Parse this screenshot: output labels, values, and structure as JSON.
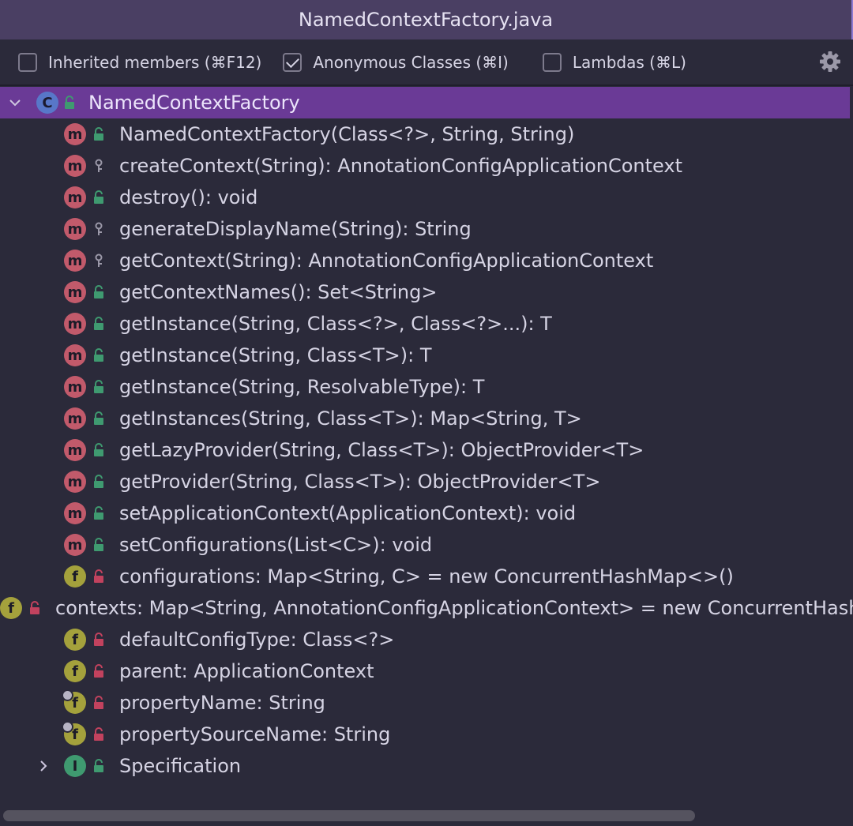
{
  "window": {
    "title": "NamedContextFactory.java"
  },
  "toolbar": {
    "options": [
      {
        "label": "Inherited members (⌘F12)",
        "checked": false
      },
      {
        "label": "Anonymous Classes (⌘I)",
        "checked": true
      },
      {
        "label": "Lambdas (⌘L)",
        "checked": false
      }
    ],
    "settings_icon": "gear-icon"
  },
  "tree": {
    "root": {
      "label": "NamedContextFactory",
      "kind": "class",
      "badge": "C",
      "expanded": true
    },
    "members": [
      {
        "badge": "m",
        "visibility": "public",
        "label": "NamedContextFactory(Class<?>, String, String)"
      },
      {
        "badge": "m",
        "visibility": "protected",
        "label": "createContext(String): AnnotationConfigApplicationContext"
      },
      {
        "badge": "m",
        "visibility": "public",
        "label": "destroy(): void"
      },
      {
        "badge": "m",
        "visibility": "protected",
        "label": "generateDisplayName(String): String"
      },
      {
        "badge": "m",
        "visibility": "protected",
        "label": "getContext(String): AnnotationConfigApplicationContext"
      },
      {
        "badge": "m",
        "visibility": "public",
        "label": "getContextNames(): Set<String>"
      },
      {
        "badge": "m",
        "visibility": "public",
        "label": "getInstance(String, Class<?>, Class<?>...): T"
      },
      {
        "badge": "m",
        "visibility": "public",
        "label": "getInstance(String, Class<T>): T"
      },
      {
        "badge": "m",
        "visibility": "public",
        "label": "getInstance(String, ResolvableType): T"
      },
      {
        "badge": "m",
        "visibility": "public",
        "label": "getInstances(String, Class<T>): Map<String, T>"
      },
      {
        "badge": "m",
        "visibility": "public",
        "label": "getLazyProvider(String, Class<T>): ObjectProvider<T>"
      },
      {
        "badge": "m",
        "visibility": "public",
        "label": "getProvider(String, Class<T>): ObjectProvider<T>"
      },
      {
        "badge": "m",
        "visibility": "public",
        "label": "setApplicationContext(ApplicationContext): void"
      },
      {
        "badge": "m",
        "visibility": "public",
        "label": "setConfigurations(List<C>): void"
      },
      {
        "badge": "f",
        "visibility": "private",
        "label": "configurations: Map<String, C> = new ConcurrentHashMap<>()"
      },
      {
        "badge": "f",
        "visibility": "private",
        "label": "contexts: Map<String, AnnotationConfigApplicationContext> = new ConcurrentHashMap<>()"
      },
      {
        "badge": "f",
        "visibility": "private",
        "label": "defaultConfigType: Class<?>"
      },
      {
        "badge": "f",
        "visibility": "private",
        "label": "parent: ApplicationContext"
      },
      {
        "badge": "f",
        "visibility": "private",
        "final": true,
        "label": "propertyName: String"
      },
      {
        "badge": "f",
        "visibility": "private",
        "final": true,
        "label": "propertySourceName: String"
      }
    ],
    "nested": {
      "badge": "I",
      "visibility": "public",
      "label": "Specification",
      "expanded": false
    }
  },
  "colors": {
    "titlebar": "#4a3f63",
    "background": "#2b2a3a",
    "selection": "#6a3a96",
    "method_badge": "#c25a6b",
    "field_badge": "#a4a13c",
    "class_badge": "#5877c9",
    "interface_badge": "#3f9a70",
    "public_lock": "#3f9a70",
    "private_lock": "#c2425e"
  }
}
